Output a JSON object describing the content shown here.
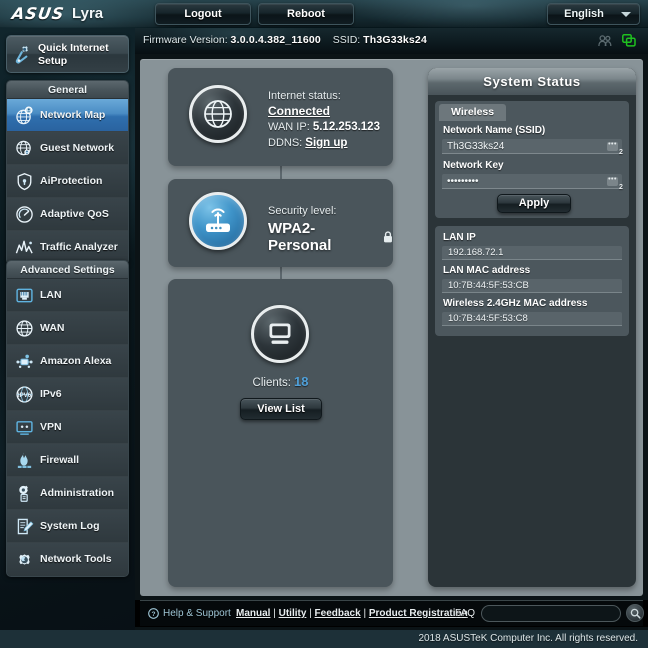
{
  "header": {
    "brand_logo": "ASUS",
    "brand_name": "Lyra",
    "logout_label": "Logout",
    "reboot_label": "Reboot",
    "language": "English"
  },
  "statusbar": {
    "firmware_label": "Firmware Version:",
    "firmware_value": "3.0.0.4.382_11600",
    "ssid_label": "SSID:",
    "ssid_value": "Th3G33ks24",
    "icons": [
      "users-icon",
      "network-devices-icon"
    ],
    "network_icon_color": "#1fc11f"
  },
  "sidebar": {
    "quick_setup": "Quick Internet Setup",
    "groups": [
      {
        "title": "General",
        "items": [
          {
            "label": "Network Map",
            "icon": "network-map-icon",
            "active": true
          },
          {
            "label": "Guest Network",
            "icon": "guest-network-icon",
            "active": false
          },
          {
            "label": "AiProtection",
            "icon": "shield-icon",
            "active": false
          },
          {
            "label": "Adaptive QoS",
            "icon": "gauge-icon",
            "active": false
          },
          {
            "label": "Traffic Analyzer",
            "icon": "traffic-chart-icon",
            "active": false
          }
        ]
      },
      {
        "title": "Advanced Settings",
        "items": [
          {
            "label": "LAN",
            "icon": "ethernet-port-icon",
            "active": false
          },
          {
            "label": "WAN",
            "icon": "globe-icon",
            "active": false
          },
          {
            "label": "Amazon Alexa",
            "icon": "alexa-icon",
            "active": false
          },
          {
            "label": "IPv6",
            "icon": "ipv6-icon",
            "active": false
          },
          {
            "label": "VPN",
            "icon": "vpn-icon",
            "active": false
          },
          {
            "label": "Firewall",
            "icon": "firewall-flame-icon",
            "active": false
          },
          {
            "label": "Administration",
            "icon": "gear-icon",
            "active": false
          },
          {
            "label": "System Log",
            "icon": "log-pencil-icon",
            "active": false
          },
          {
            "label": "Network Tools",
            "icon": "tools-gear-icon",
            "active": false
          }
        ]
      }
    ]
  },
  "internet_panel": {
    "icon": "globe-icon",
    "status_label": "Internet status:",
    "status_value": "Connected",
    "wanip_label": "WAN IP:",
    "wanip_value": "5.12.253.123",
    "ddns_label": "DDNS:",
    "ddns_value": "Sign up"
  },
  "security_panel": {
    "icon": "router-wifi-icon",
    "label": "Security level:",
    "value": "WPA2-Personal",
    "lock_icon": "lock-icon"
  },
  "clients_panel": {
    "icon": "monitor-icon",
    "label": "Clients:",
    "count": "18",
    "button_label": "View List",
    "count_color": "#4f9fd8"
  },
  "system_status": {
    "title": "System Status",
    "tab": "Wireless",
    "ssid_label": "Network Name (SSID)",
    "ssid_value": "Th3G33ks24",
    "key_label": "Network Key",
    "key_value": "•••••••••",
    "field_badge": "2",
    "field_more": "•••",
    "apply_label": "Apply",
    "info_rows": [
      {
        "label": "LAN IP",
        "value": "192.168.72.1"
      },
      {
        "label": "LAN MAC address",
        "value": "10:7B:44:5F:53:CB"
      },
      {
        "label": "Wireless 2.4GHz MAC address",
        "value": "10:7B:44:5F:53:C8"
      }
    ]
  },
  "footer": {
    "help_label": "Help & Support",
    "links": [
      "Manual",
      "Utility",
      "Feedback",
      "Product Registration"
    ],
    "faq_label": "FAQ",
    "search_placeholder": "",
    "search_value": "",
    "copyright": "2018 ASUSTeK Computer Inc. All rights reserved."
  }
}
